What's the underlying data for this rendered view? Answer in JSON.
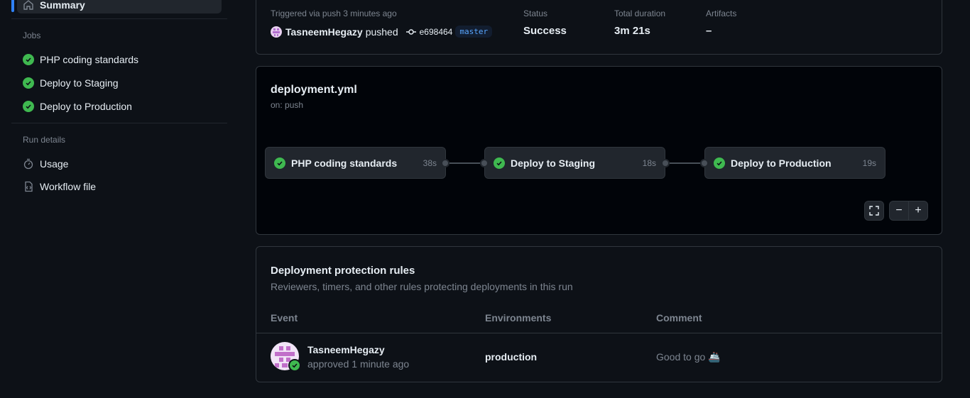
{
  "sidebar": {
    "summary_label": "Summary",
    "jobs_title": "Jobs",
    "jobs": [
      {
        "label": "PHP coding standards"
      },
      {
        "label": "Deploy to Staging"
      },
      {
        "label": "Deploy to Production"
      }
    ],
    "run_details_title": "Run details",
    "details": [
      {
        "label": "Usage",
        "icon": "stopwatch-icon"
      },
      {
        "label": "Workflow file",
        "icon": "file-code-icon"
      }
    ]
  },
  "run": {
    "trigger_text": "Triggered via push 3 minutes ago",
    "user": "TasneemHegazy",
    "action": "pushed",
    "commit": "e698464",
    "branch": "master",
    "status_label": "Status",
    "status_value": "Success",
    "duration_label": "Total duration",
    "duration_value": "3m 21s",
    "artifacts_label": "Artifacts",
    "artifacts_value": "–"
  },
  "workflow": {
    "file": "deployment.yml",
    "trigger": "on: push",
    "jobs": [
      {
        "name": "PHP coding standards",
        "duration": "38s"
      },
      {
        "name": "Deploy to Staging",
        "duration": "18s"
      },
      {
        "name": "Deploy to Production",
        "duration": "19s"
      }
    ],
    "controls": {
      "fullscreen": "⛶",
      "zoom_out": "−",
      "zoom_in": "+"
    }
  },
  "rules": {
    "title": "Deployment protection rules",
    "subtitle": "Reviewers, timers, and other rules protecting deployments in this run",
    "columns": [
      "Event",
      "Environments",
      "Comment"
    ],
    "rows": [
      {
        "user": "TasneemHegazy",
        "event_detail": "approved 1 minute ago",
        "environment": "production",
        "comment": "Good to go 🚢"
      }
    ]
  },
  "colors": {
    "accent": "#2f81f7",
    "success": "#3fb950",
    "background": "#0d1117"
  }
}
